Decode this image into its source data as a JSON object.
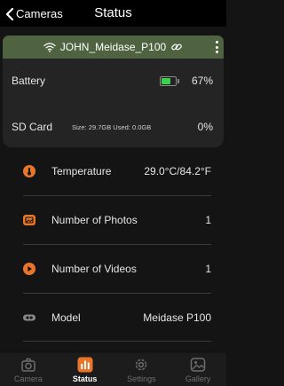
{
  "header": {
    "back_label": "Cameras",
    "title": "Status"
  },
  "device": {
    "name": "JOHN_Meidase_P100",
    "wifi_icon": "wifi-icon",
    "link_icon": "link-icon",
    "menu_icon": "more-vertical-icon"
  },
  "summary": {
    "battery": {
      "label": "Battery",
      "percent_text": "67%",
      "level": 0.67,
      "icon": "battery-icon",
      "fill_color": "#3ad24c"
    },
    "sd_card": {
      "label": "SD Card",
      "size_text": "Size: 29.7GB Used: 0.0GB",
      "percent_text": "0%"
    }
  },
  "status_items": [
    {
      "label": "Temperature",
      "value": "29.0°C/84.2°F",
      "icon": "thermometer-icon",
      "icon_color": "#e8762a"
    },
    {
      "label": "Number of Photos",
      "value": "1",
      "icon": "photo-icon",
      "icon_color": "#e8762a"
    },
    {
      "label": "Number of Videos",
      "value": "1",
      "icon": "video-play-icon",
      "icon_color": "#e8762a"
    },
    {
      "label": "Model",
      "value": "Meidase P100",
      "icon": "camera-model-icon",
      "icon_color": "#8a8a8a"
    }
  ],
  "tabs": [
    {
      "label": "Camera",
      "icon": "camera-icon",
      "active": false
    },
    {
      "label": "Status",
      "icon": "status-chart-icon",
      "active": true
    },
    {
      "label": "Settings",
      "icon": "settings-gear-icon",
      "active": false
    },
    {
      "label": "Gallery",
      "icon": "gallery-icon",
      "active": false
    }
  ],
  "colors": {
    "accent": "#e8762a",
    "device_bar": "#4f6340",
    "background": "#141414",
    "panel": "#242424"
  }
}
